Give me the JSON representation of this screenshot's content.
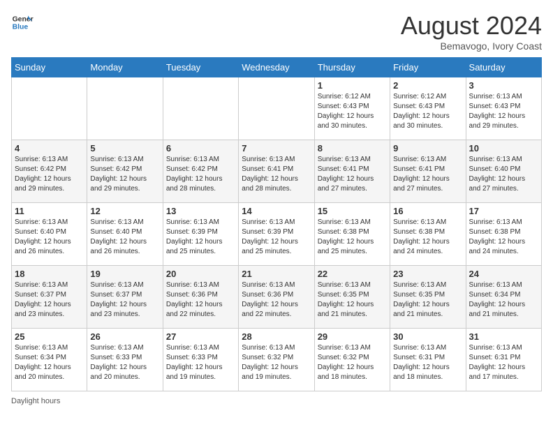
{
  "header": {
    "logo_line1": "General",
    "logo_line2": "Blue",
    "month_year": "August 2024",
    "location": "Bemavogo, Ivory Coast"
  },
  "days_of_week": [
    "Sunday",
    "Monday",
    "Tuesday",
    "Wednesday",
    "Thursday",
    "Friday",
    "Saturday"
  ],
  "weeks": [
    [
      {
        "day": "",
        "info": ""
      },
      {
        "day": "",
        "info": ""
      },
      {
        "day": "",
        "info": ""
      },
      {
        "day": "",
        "info": ""
      },
      {
        "day": "1",
        "info": "Sunrise: 6:12 AM\nSunset: 6:43 PM\nDaylight: 12 hours\nand 30 minutes."
      },
      {
        "day": "2",
        "info": "Sunrise: 6:12 AM\nSunset: 6:43 PM\nDaylight: 12 hours\nand 30 minutes."
      },
      {
        "day": "3",
        "info": "Sunrise: 6:13 AM\nSunset: 6:43 PM\nDaylight: 12 hours\nand 29 minutes."
      }
    ],
    [
      {
        "day": "4",
        "info": "Sunrise: 6:13 AM\nSunset: 6:42 PM\nDaylight: 12 hours\nand 29 minutes."
      },
      {
        "day": "5",
        "info": "Sunrise: 6:13 AM\nSunset: 6:42 PM\nDaylight: 12 hours\nand 29 minutes."
      },
      {
        "day": "6",
        "info": "Sunrise: 6:13 AM\nSunset: 6:42 PM\nDaylight: 12 hours\nand 28 minutes."
      },
      {
        "day": "7",
        "info": "Sunrise: 6:13 AM\nSunset: 6:41 PM\nDaylight: 12 hours\nand 28 minutes."
      },
      {
        "day": "8",
        "info": "Sunrise: 6:13 AM\nSunset: 6:41 PM\nDaylight: 12 hours\nand 27 minutes."
      },
      {
        "day": "9",
        "info": "Sunrise: 6:13 AM\nSunset: 6:41 PM\nDaylight: 12 hours\nand 27 minutes."
      },
      {
        "day": "10",
        "info": "Sunrise: 6:13 AM\nSunset: 6:40 PM\nDaylight: 12 hours\nand 27 minutes."
      }
    ],
    [
      {
        "day": "11",
        "info": "Sunrise: 6:13 AM\nSunset: 6:40 PM\nDaylight: 12 hours\nand 26 minutes."
      },
      {
        "day": "12",
        "info": "Sunrise: 6:13 AM\nSunset: 6:40 PM\nDaylight: 12 hours\nand 26 minutes."
      },
      {
        "day": "13",
        "info": "Sunrise: 6:13 AM\nSunset: 6:39 PM\nDaylight: 12 hours\nand 25 minutes."
      },
      {
        "day": "14",
        "info": "Sunrise: 6:13 AM\nSunset: 6:39 PM\nDaylight: 12 hours\nand 25 minutes."
      },
      {
        "day": "15",
        "info": "Sunrise: 6:13 AM\nSunset: 6:38 PM\nDaylight: 12 hours\nand 25 minutes."
      },
      {
        "day": "16",
        "info": "Sunrise: 6:13 AM\nSunset: 6:38 PM\nDaylight: 12 hours\nand 24 minutes."
      },
      {
        "day": "17",
        "info": "Sunrise: 6:13 AM\nSunset: 6:38 PM\nDaylight: 12 hours\nand 24 minutes."
      }
    ],
    [
      {
        "day": "18",
        "info": "Sunrise: 6:13 AM\nSunset: 6:37 PM\nDaylight: 12 hours\nand 23 minutes."
      },
      {
        "day": "19",
        "info": "Sunrise: 6:13 AM\nSunset: 6:37 PM\nDaylight: 12 hours\nand 23 minutes."
      },
      {
        "day": "20",
        "info": "Sunrise: 6:13 AM\nSunset: 6:36 PM\nDaylight: 12 hours\nand 22 minutes."
      },
      {
        "day": "21",
        "info": "Sunrise: 6:13 AM\nSunset: 6:36 PM\nDaylight: 12 hours\nand 22 minutes."
      },
      {
        "day": "22",
        "info": "Sunrise: 6:13 AM\nSunset: 6:35 PM\nDaylight: 12 hours\nand 21 minutes."
      },
      {
        "day": "23",
        "info": "Sunrise: 6:13 AM\nSunset: 6:35 PM\nDaylight: 12 hours\nand 21 minutes."
      },
      {
        "day": "24",
        "info": "Sunrise: 6:13 AM\nSunset: 6:34 PM\nDaylight: 12 hours\nand 21 minutes."
      }
    ],
    [
      {
        "day": "25",
        "info": "Sunrise: 6:13 AM\nSunset: 6:34 PM\nDaylight: 12 hours\nand 20 minutes."
      },
      {
        "day": "26",
        "info": "Sunrise: 6:13 AM\nSunset: 6:33 PM\nDaylight: 12 hours\nand 20 minutes."
      },
      {
        "day": "27",
        "info": "Sunrise: 6:13 AM\nSunset: 6:33 PM\nDaylight: 12 hours\nand 19 minutes."
      },
      {
        "day": "28",
        "info": "Sunrise: 6:13 AM\nSunset: 6:32 PM\nDaylight: 12 hours\nand 19 minutes."
      },
      {
        "day": "29",
        "info": "Sunrise: 6:13 AM\nSunset: 6:32 PM\nDaylight: 12 hours\nand 18 minutes."
      },
      {
        "day": "30",
        "info": "Sunrise: 6:13 AM\nSunset: 6:31 PM\nDaylight: 12 hours\nand 18 minutes."
      },
      {
        "day": "31",
        "info": "Sunrise: 6:13 AM\nSunset: 6:31 PM\nDaylight: 12 hours\nand 17 minutes."
      }
    ]
  ],
  "footer": {
    "daylight_label": "Daylight hours"
  }
}
